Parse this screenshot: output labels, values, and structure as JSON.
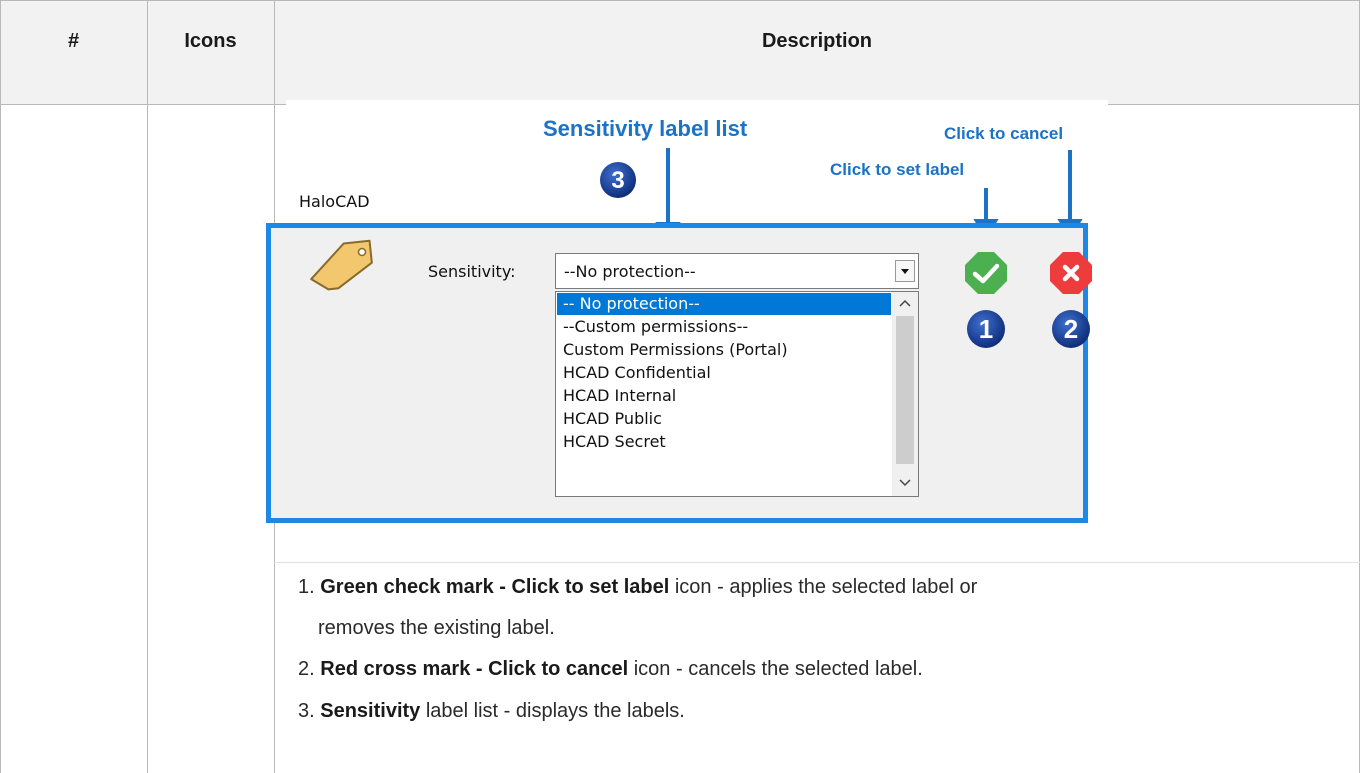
{
  "table": {
    "headers": {
      "number": "#",
      "icons": "Icons",
      "description": "Description"
    }
  },
  "screenshot": {
    "callouts": {
      "list": "Sensitivity label list",
      "cancel": "Click to cancel",
      "set": "Click to set label"
    },
    "badges": {
      "one": "1",
      "two": "2",
      "three": "3"
    },
    "app_title": "HaloCAD",
    "sensitivity_label": "Sensitivity:",
    "combo_value": "--No protection--",
    "options": [
      "-- No protection--",
      "--Custom permissions--",
      "Custom Permissions (Portal)",
      "HCAD Confidential",
      "HCAD Internal",
      "HCAD Public",
      "HCAD Secret"
    ],
    "colors": {
      "callout": "#1a73c7",
      "frame": "#1e88e5",
      "check": "#4caf50",
      "cross": "#ee3b3b",
      "badge": "#1f4aa8",
      "selection": "#0078d7"
    }
  },
  "steps": [
    {
      "num": "1.",
      "bold": "Green check mark - Click to set label",
      "rest": " icon - applies the selected label or",
      "cont": "removes the existing label."
    },
    {
      "num": "2.",
      "bold": "Red cross mark - Click to cancel",
      "rest": " icon - cancels the selected label."
    },
    {
      "num": "3.",
      "bold": "Sensitivity",
      "rest": " label list - displays the labels."
    }
  ]
}
